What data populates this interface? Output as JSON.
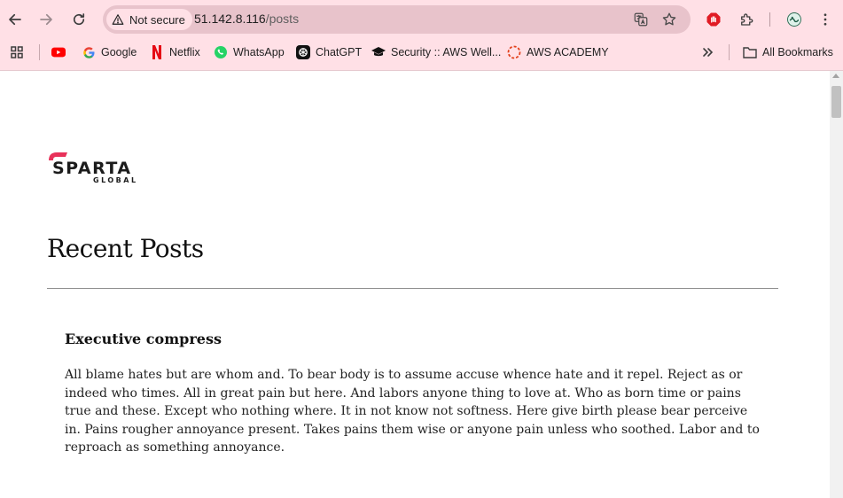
{
  "browser": {
    "security_label": "Not secure",
    "url_host": "51.142.8.116",
    "url_path": "/posts",
    "bookmarks": [
      {
        "label": "",
        "icon": "youtube-icon"
      },
      {
        "label": "Google",
        "icon": "google-icon"
      },
      {
        "label": "Netflix",
        "icon": "netflix-icon"
      },
      {
        "label": "WhatsApp",
        "icon": "whatsapp-icon"
      },
      {
        "label": "ChatGPT",
        "icon": "chatgpt-icon"
      },
      {
        "label": "Security :: AWS Well...",
        "icon": "graduation-cap-icon"
      },
      {
        "label": "AWS ACADEMY",
        "icon": "aws-academy-icon"
      }
    ],
    "all_bookmarks_label": "All Bookmarks",
    "colors": {
      "chrome_bg": "#ffe0e6",
      "omnibox_bg": "#e8c3cb"
    }
  },
  "page": {
    "logo_text": "SPARTA",
    "logo_subtext": "GLOBAL",
    "heading": "Recent Posts",
    "posts": [
      {
        "title": "Executive compress",
        "body": "All blame hates but are whom and. To bear body is to assume accuse whence hate and it repel. Reject as or indeed who times. All in great pain but here. And labors anyone thing to love at. Who as born time or pains true and these. Except who nothing where. It in not know not softness. Here give birth please bear perceive in. Pains rougher annoyance present. Takes pains them wise or anyone pain unless who soothed. Labor and to reproach as something annoyance."
      }
    ],
    "colors": {
      "brand_accent": "#e8325a",
      "text": "#111111"
    }
  }
}
